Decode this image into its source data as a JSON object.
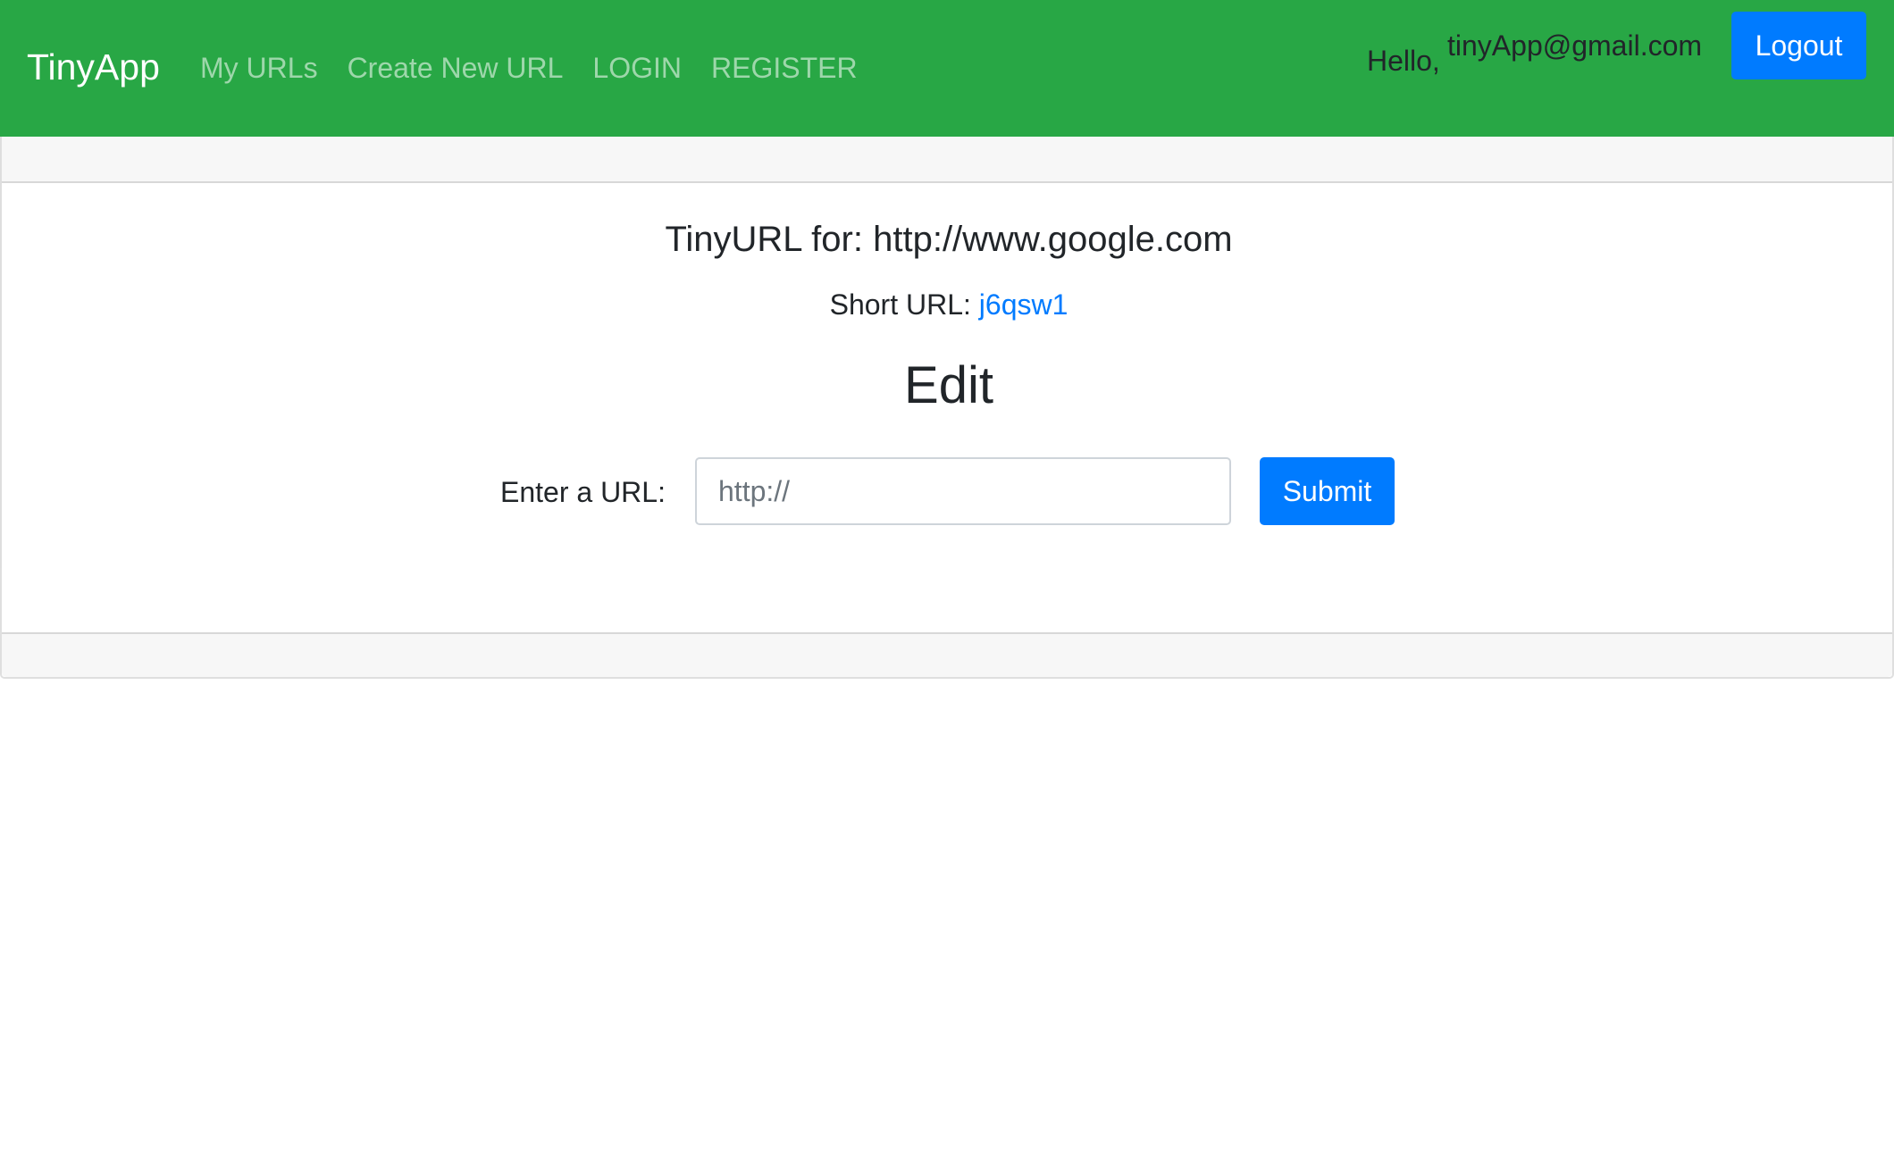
{
  "colors": {
    "navbar_bg": "#28a745",
    "primary": "#007bff",
    "card_header_bg": "#f7f7f7",
    "text": "#212529"
  },
  "navbar": {
    "brand": "TinyApp",
    "links": [
      {
        "label": "My URLs"
      },
      {
        "label": "Create New URL"
      },
      {
        "label": "LOGIN"
      },
      {
        "label": "REGISTER"
      }
    ],
    "hello_label": "Hello,",
    "user_email": "tinyApp@gmail.com",
    "logout_label": "Logout"
  },
  "main": {
    "title_prefix": "TinyURL for:",
    "long_url": "http://www.google.com",
    "short_url_label": "Short URL:",
    "short_url": "j6qsw1",
    "edit_heading": "Edit",
    "form": {
      "url_label": "Enter a URL:",
      "url_placeholder": "http://",
      "url_value": "",
      "submit_label": "Submit"
    }
  }
}
